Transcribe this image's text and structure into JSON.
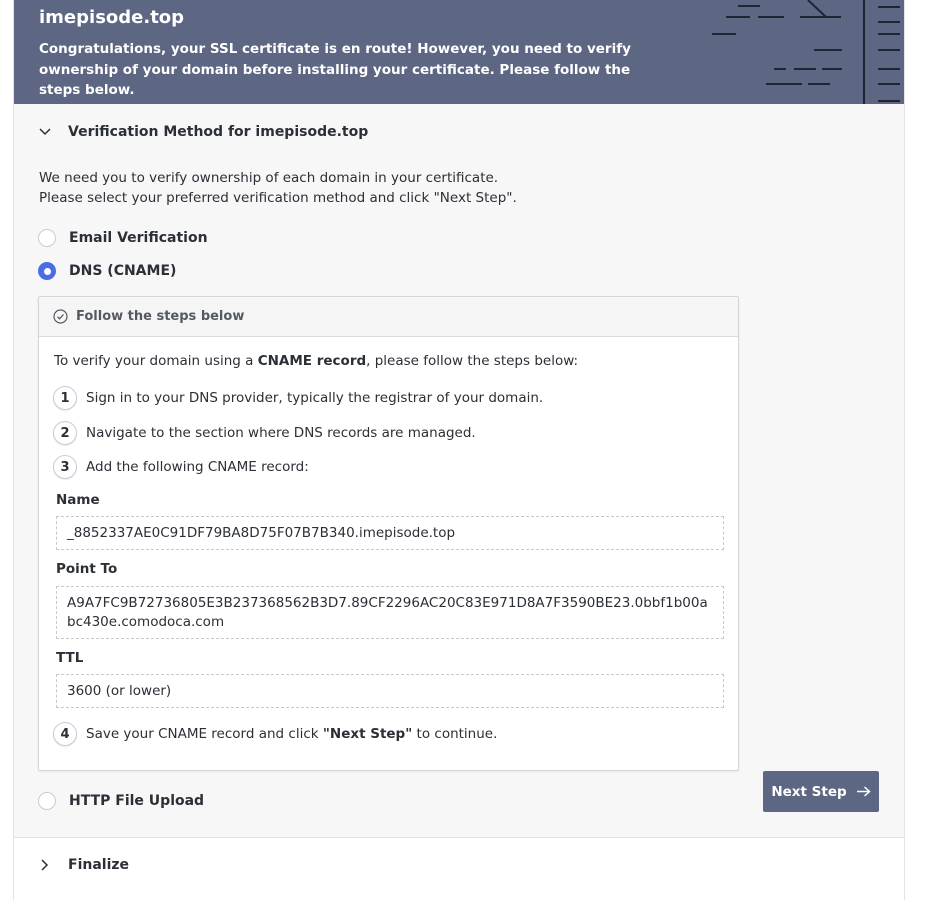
{
  "header": {
    "domain": "imepisode.top",
    "message": "Congratulations, your SSL certificate is en route! However, you need to verify ownership of your domain before installing your certificate. Please follow the steps below."
  },
  "verification": {
    "section_title": "Verification Method for imepisode.top",
    "intro_line1": "We need you to verify ownership of each domain in your certificate.",
    "intro_line2": "Please select your preferred verification method and click \"Next Step\".",
    "options": [
      {
        "label": "Email Verification",
        "checked": false
      },
      {
        "label": "DNS (CNAME)",
        "checked": true
      },
      {
        "label": "HTTP File Upload",
        "checked": false
      }
    ],
    "panel": {
      "title": "Follow the steps below",
      "lead_before": "To verify your domain using a ",
      "lead_bold": "CNAME record",
      "lead_after": ", please follow the steps below:",
      "steps": [
        {
          "num": "1",
          "text": "Sign in to your DNS provider, typically the registrar of your domain."
        },
        {
          "num": "2",
          "text": "Navigate to the section where DNS records are managed."
        },
        {
          "num": "3",
          "text": "Add the following CNAME record:"
        },
        {
          "num": "4",
          "text_before": "Save your CNAME record and click ",
          "text_bold": "\"Next Step\"",
          "text_after": " to continue."
        }
      ],
      "fields": {
        "name_label": "Name",
        "name_value": "_8852337AE0C91DF79BA8D75F07B7B340.imepisode.top",
        "point_label": "Point To",
        "point_value": "A9A7FC9B72736805E3B237368562B3D7.89CF2296AC20C83E971D8A7F3590BE23.0bbf1b00abc430e.comodoca.com",
        "ttl_label": "TTL",
        "ttl_value": "3600 (or lower)"
      }
    }
  },
  "actions": {
    "next_step": "Next Step"
  },
  "finalize": {
    "title": "Finalize"
  },
  "colors": {
    "header_bg": "#5d6682",
    "accent": "#4a6de5",
    "button_bg": "#5d6682"
  },
  "icons": {
    "section_open": "chevron-down-icon",
    "section_closed": "chevron-right-icon",
    "panel": "check-circle-icon",
    "next": "arrow-right-icon"
  }
}
